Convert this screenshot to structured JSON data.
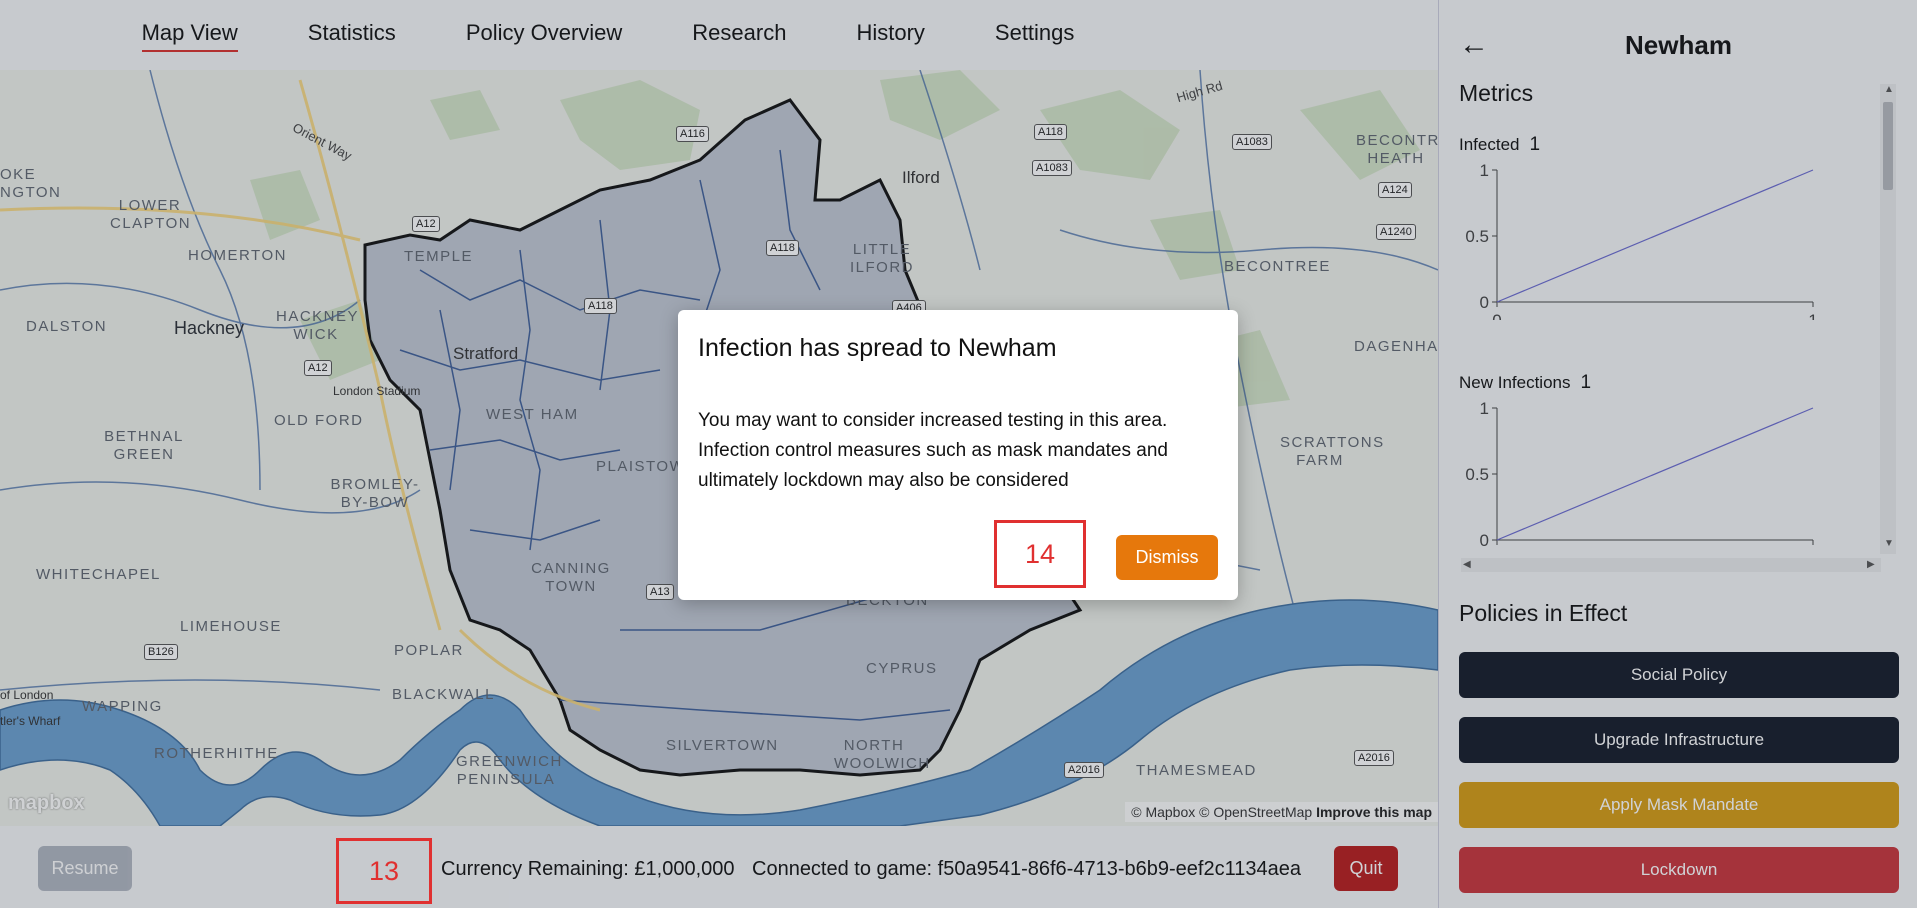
{
  "nav": {
    "tabs": [
      {
        "label": "Map View",
        "active": true
      },
      {
        "label": "Statistics"
      },
      {
        "label": "Policy Overview"
      },
      {
        "label": "Research"
      },
      {
        "label": "History"
      },
      {
        "label": "Settings"
      }
    ]
  },
  "map": {
    "places": {
      "hackney": "Hackney",
      "stratford": "Stratford",
      "ilford": "Ilford",
      "homerton": "HOMERTON",
      "lower_clapton": "LOWER CLAPTON",
      "dalston": "DALSTON",
      "hackney_wick": "HACKNEY WICK",
      "temple": "TEMPLE",
      "little_ilford": "LITTLE ILFORD",
      "london_stadium": "London Stadium",
      "old_ford": "OLD FORD",
      "west_ham": "WEST HAM",
      "plaistow": "PLAISTOW",
      "bethnal_green": "BETHNAL GREEN",
      "bromley_by_bow": "BROMLEY-BY-BOW",
      "whitechapel": "WHITECHAPEL",
      "canning_town": "CANNING TOWN",
      "limehouse": "LIMEHOUSE",
      "poplar": "POPLAR",
      "wapping": "WAPPING",
      "rotherhithe": "ROTHERHITHE",
      "blackwall": "BLACKWALL",
      "greenwich_peninsula": "GREENWICH PENINSULA",
      "silvertown": "SILVERTOWN",
      "north_woolwich": "NORTH WOOLWICH",
      "cyprus": "CYPRUS",
      "beckton": "BECKTON",
      "thamesmead": "THAMESMEAD",
      "becontree": "BECONTREE",
      "becontree_heath": "BECONTREE HEATH",
      "dagenham": "DAGENHAM",
      "scrattons_farm": "SCRATTONS FARM",
      "orient_way": "Orient Way",
      "high_rd": "High Rd",
      "ngton": "NGTON",
      "oke": "OKE",
      "of_london": "of London",
      "tlers_wharf": "tler's Wharf"
    },
    "roads": {
      "a116": "A116",
      "a118a": "A118",
      "a1083": "A1083",
      "a1083b": "A1083",
      "a124": "A124",
      "a1240": "A1240",
      "a12a": "A12",
      "a118b": "A118",
      "a406": "A406",
      "a118c": "A118",
      "a12b": "A12",
      "a13": "A13",
      "b126": "B126",
      "a2016a": "A2016",
      "a2016b": "A2016"
    },
    "logo": "mapbox",
    "attribution_text": "© Mapbox © OpenStreetMap",
    "attribution_link": "Improve this map"
  },
  "bottom": {
    "resume": "Resume",
    "currency": "Currency Remaining: £1,000,000",
    "connected": "Connected to game: f50a9541-86f6-4713-b6b9-eef2c1134aea",
    "quit": "Quit"
  },
  "annotations": {
    "a13": "13",
    "a14": "14"
  },
  "modal": {
    "title": "Infection has spread to Newham",
    "body": "You may want to consider increased testing in this area. Infection control measures such as mask mandates and ultimately lockdown may also be considered",
    "dismiss": "Dismiss"
  },
  "side": {
    "title": "Newham",
    "metrics_heading": "Metrics",
    "infected_label": "Infected",
    "infected_value": "1",
    "new_inf_label": "New Infections",
    "new_inf_value": "1",
    "policies_heading": "Policies in Effect",
    "policies": [
      "Social Policy",
      "Upgrade Infrastructure",
      "Apply Mask Mandate",
      "Lockdown"
    ]
  },
  "chart_data": [
    {
      "type": "line",
      "title": "",
      "x": [
        0,
        1
      ],
      "y": [
        0,
        1
      ],
      "xlim": [
        0,
        1
      ],
      "ylim": [
        0,
        1
      ],
      "yticks": [
        "0",
        "0.5",
        "1"
      ],
      "xticks": [
        "0",
        "1"
      ]
    },
    {
      "type": "line",
      "title": "",
      "x": [
        0,
        1
      ],
      "y": [
        0,
        1
      ],
      "xlim": [
        0,
        1
      ],
      "ylim": [
        0,
        1
      ],
      "yticks": [
        "0",
        "0.5",
        "1"
      ],
      "xticks": [
        "0",
        "1"
      ]
    }
  ],
  "colors": {
    "accent": "#d9302c",
    "dismiss": "#e6780c",
    "quit": "#b81c1c",
    "policy_dark": "#141a28",
    "policy_mask": "#d59b12",
    "policy_lockdown": "#c8343a",
    "line": "#6b6bd0"
  }
}
